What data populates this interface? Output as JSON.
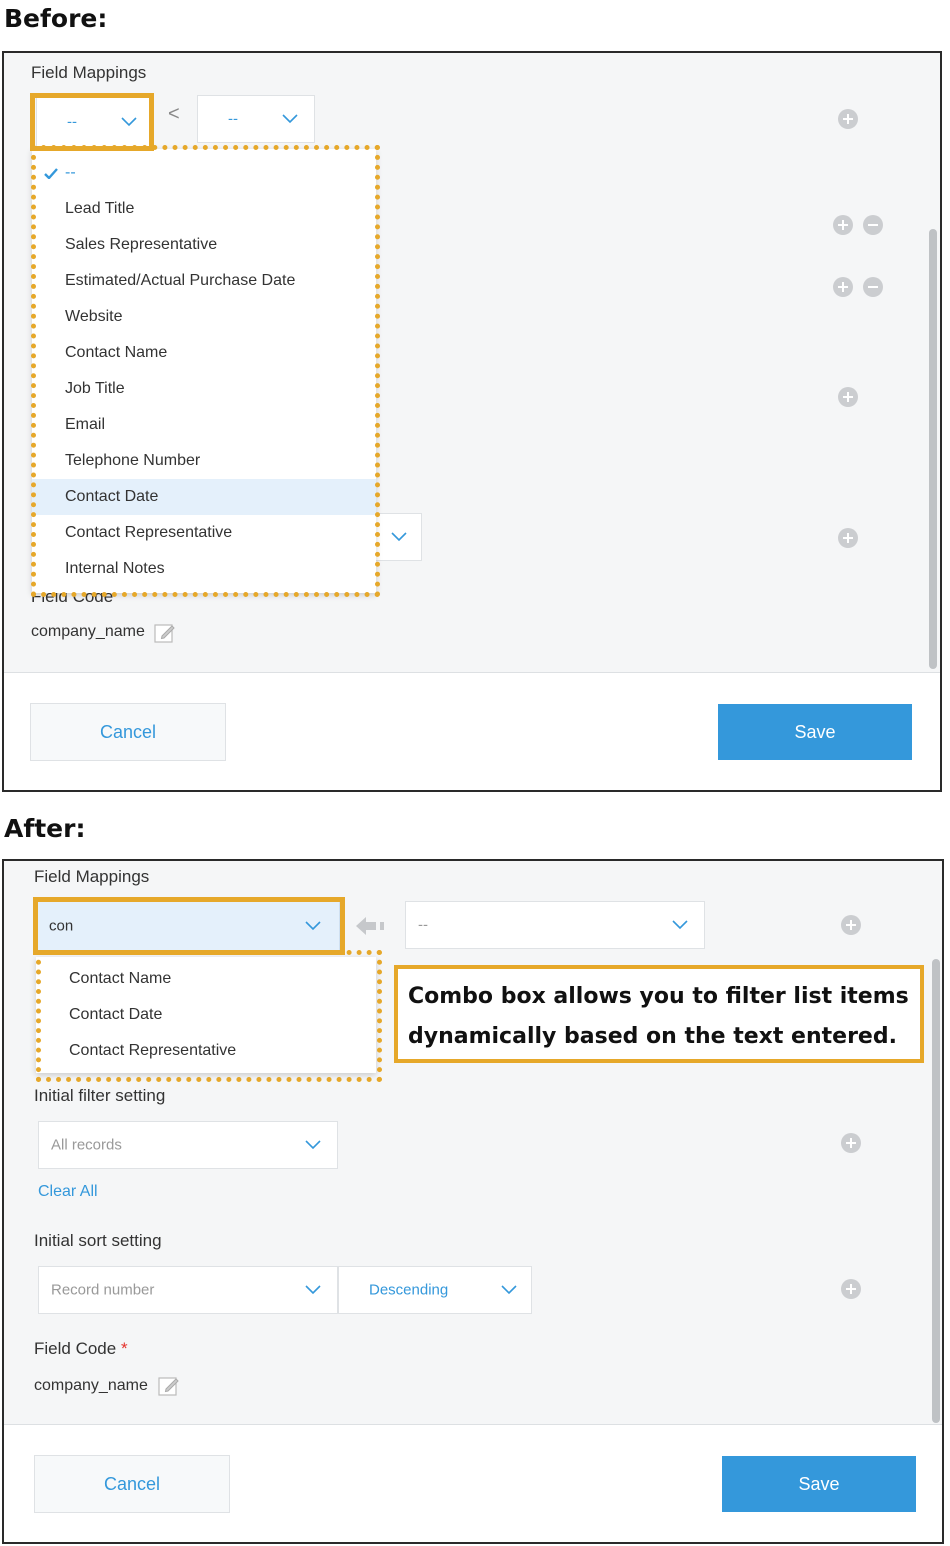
{
  "before": {
    "heading": "Before:",
    "section_label": "Field Mappings",
    "left_select_value": "--",
    "right_select_value": "--",
    "arrow": "<",
    "dropdown_selected": "--",
    "dropdown_items": [
      "Lead Title",
      "Sales Representative",
      "Estimated/Actual Purchase Date",
      "Website",
      "Contact Name",
      "Job Title",
      "Email",
      "Telephone Number",
      "Contact Date",
      "Contact Representative",
      "Internal Notes"
    ],
    "highlighted_item": "Contact Date",
    "field_code_label_partial": "Field Code",
    "field_code_value": "company_name",
    "cancel_label": "Cancel",
    "save_label": "Save"
  },
  "after": {
    "heading": "After:",
    "section_label": "Field Mappings",
    "combo_value": "con",
    "right_select_value": "--",
    "filtered_items": [
      "Contact Name",
      "Contact Date",
      "Contact Representative"
    ],
    "callout_line1": "Combo box allows you to filter list items",
    "callout_line2": "dynamically based on the text entered.",
    "initial_filter_label": "Initial filter setting",
    "filter_select_value": "All records",
    "clear_all_label": "Clear All",
    "initial_sort_label": "Initial sort setting",
    "sort_field_value": "Record number",
    "sort_order_value": "Descending",
    "field_code_label": "Field Code",
    "required_mark": "*",
    "field_code_value": "company_name",
    "cancel_label": "Cancel",
    "save_label": "Save"
  },
  "colors": {
    "accent": "#3498db",
    "highlight": "#e6a82a",
    "required": "#e4322c",
    "panel_bg": "#f5f6f7"
  },
  "icons": [
    "checkmark-icon",
    "chevron-down-icon",
    "chevron-left-icon",
    "arrow-left-icon",
    "plus-circle-icon",
    "minus-circle-icon",
    "edit-icon"
  ]
}
